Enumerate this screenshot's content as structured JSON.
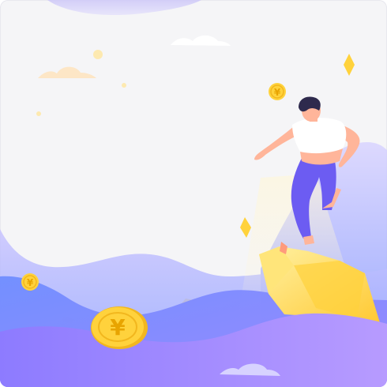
{
  "scene": {
    "coin_symbol": "¥",
    "colors": {
      "background": "#f5f5f7",
      "wave_back": "#b9b4ff",
      "wave_mid": "#8a84ff",
      "wave_front": "#a58cff",
      "coin": "#ffd23c",
      "coin_dark": "#f2b71e",
      "rock": "#ffd84a",
      "shirt": "#ffffff",
      "pants": "#6c5cf2",
      "skin": "#ffb59a",
      "hair": "#2e2a4d",
      "cloud_light": "#ffffff",
      "cloud_warm": "#fde6c6",
      "sparkle": "#ffd23c"
    },
    "icons": [
      "yen-coin-icon",
      "diamond-sparkle-icon",
      "cloud-icon"
    ]
  }
}
